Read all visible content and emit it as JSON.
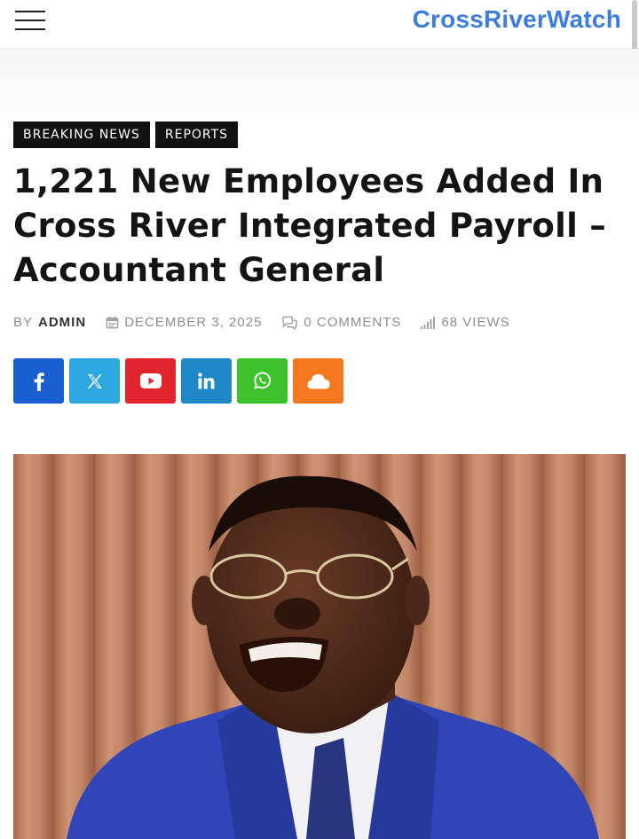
{
  "header": {
    "brand": "CrossRiverWatch"
  },
  "categories": [
    "BREAKING NEWS",
    "REPORTS"
  ],
  "article": {
    "title": "1,221 New Employees Added In Cross River Integrated Payroll – Accountant General",
    "meta": {
      "by_label": "BY",
      "author": "ADMIN",
      "date": "DECEMBER 3, 2025",
      "comments": "0 COMMENTS",
      "views": "68 VIEWS"
    }
  },
  "share_buttons": [
    {
      "icon": "facebook-icon",
      "color": "#1a5fd1"
    },
    {
      "icon": "x-icon",
      "color": "#2ca7e0"
    },
    {
      "icon": "youtube-icon",
      "color": "#e1252f"
    },
    {
      "icon": "linkedin-icon",
      "color": "#1f88c9"
    },
    {
      "icon": "whatsapp-icon",
      "color": "#3ec22b"
    },
    {
      "icon": "cloud-icon",
      "color": "#f5771f"
    }
  ],
  "colors": {
    "brand": "#3d7dde",
    "tag_bg": "#111111",
    "meta": "#8e8e8e"
  }
}
